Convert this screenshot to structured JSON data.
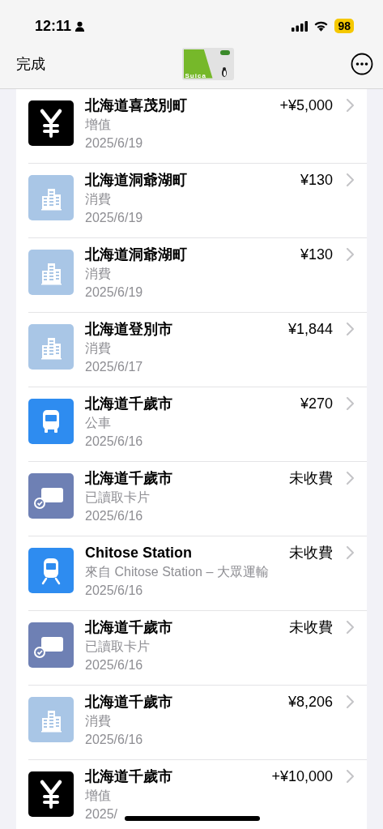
{
  "status_bar": {
    "time": "12:11",
    "battery": "98"
  },
  "nav": {
    "done": "完成",
    "card_label": "Suica"
  },
  "transactions": [
    {
      "kind": "yen",
      "title": "北海道喜茂別町",
      "amount": "+¥5,000",
      "detail": "增值",
      "date": "2025/6/19"
    },
    {
      "kind": "city",
      "title": "北海道洞爺湖町",
      "amount": "¥130",
      "detail": "消費",
      "date": "2025/6/19"
    },
    {
      "kind": "city",
      "title": "北海道洞爺湖町",
      "amount": "¥130",
      "detail": "消費",
      "date": "2025/6/19"
    },
    {
      "kind": "city",
      "title": "北海道登別市",
      "amount": "¥1,844",
      "detail": "消費",
      "date": "2025/6/17"
    },
    {
      "kind": "bus",
      "title": "北海道千歲市",
      "amount": "¥270",
      "detail": "公車",
      "date": "2025/6/16"
    },
    {
      "kind": "card",
      "title": "北海道千歲市",
      "amount": "未收費",
      "detail": "已讀取卡片",
      "date": "2025/6/16"
    },
    {
      "kind": "train",
      "title": "Chitose Station",
      "amount": "未收費",
      "detail": "來自 Chitose Station – 大眾運輸",
      "date": "2025/6/16"
    },
    {
      "kind": "card",
      "title": "北海道千歲市",
      "amount": "未收費",
      "detail": "已讀取卡片",
      "date": "2025/6/16"
    },
    {
      "kind": "city",
      "title": "北海道千歲市",
      "amount": "¥8,206",
      "detail": "消費",
      "date": "2025/6/16"
    },
    {
      "kind": "yen",
      "title": "北海道千歲市",
      "amount": "+¥10,000",
      "detail": "增值",
      "date": "2025/"
    }
  ]
}
